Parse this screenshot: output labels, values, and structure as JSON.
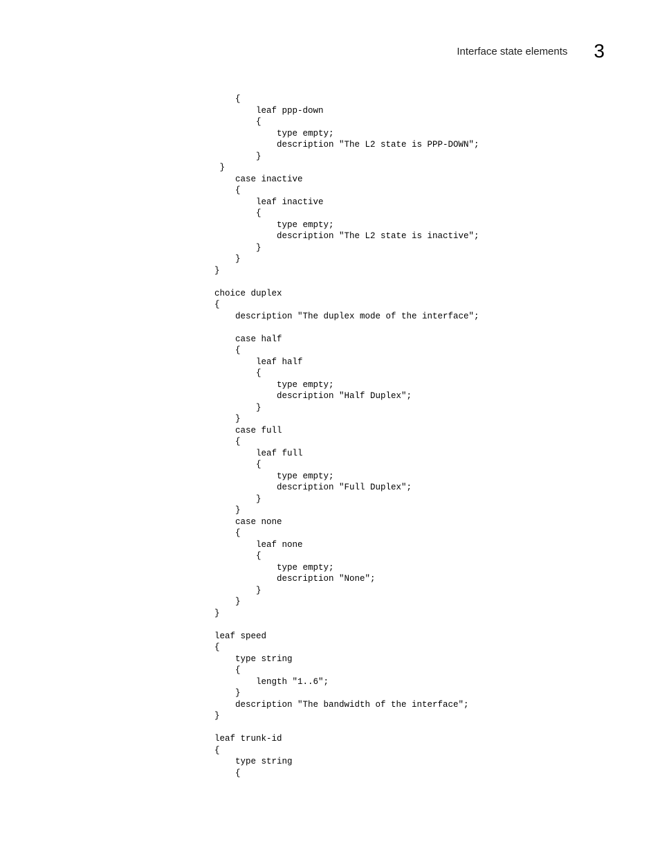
{
  "header": {
    "title": "Interface state elements",
    "chapter_number": "3"
  },
  "code": "    {\n        leaf ppp-down\n        {\n            type empty;\n            description \"The L2 state is PPP-DOWN\";\n        }\n }\n    case inactive\n    {\n        leaf inactive\n        {\n            type empty;\n            description \"The L2 state is inactive\";\n        }\n    }\n}\n\nchoice duplex\n{\n    description \"The duplex mode of the interface\";\n\n    case half\n    {\n        leaf half\n        {\n            type empty;\n            description \"Half Duplex\";\n        }\n    }\n    case full\n    {\n        leaf full\n        {\n            type empty;\n            description \"Full Duplex\";\n        }\n    }\n    case none\n    {\n        leaf none\n        {\n            type empty;\n            description \"None\";\n        }\n    }\n}\n\nleaf speed\n{\n    type string\n    {\n        length \"1..6\";\n    }\n    description \"The bandwidth of the interface\";\n}\n\nleaf trunk-id\n{\n    type string\n    {"
}
